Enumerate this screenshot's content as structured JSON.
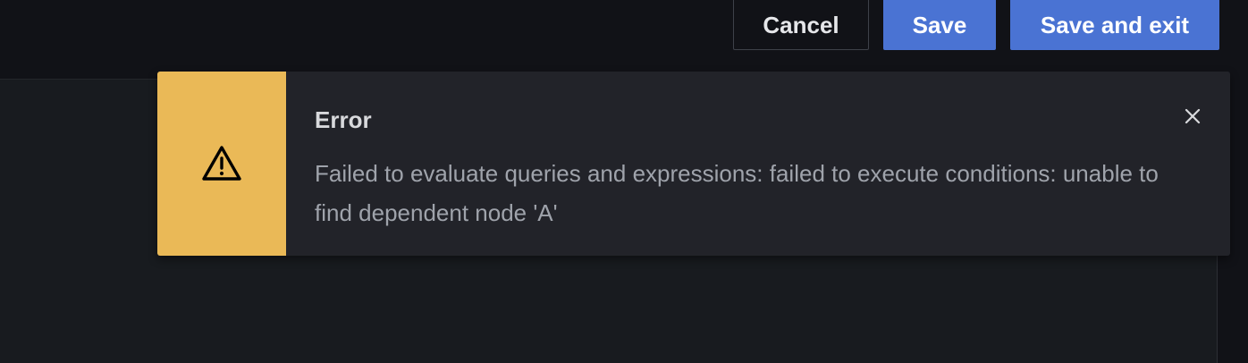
{
  "toolbar": {
    "cancel_label": "Cancel",
    "save_label": "Save",
    "save_exit_label": "Save and exit"
  },
  "alert": {
    "severity": "warning",
    "icon": "exclamation-triangle-icon",
    "title": "Error",
    "message": "Failed to evaluate queries and expressions: failed to execute conditions: unable to find dependent node 'A'",
    "close_icon": "close-icon"
  },
  "colors": {
    "accent_primary": "#4a73d3",
    "warning": "#eab957",
    "alert_background": "#222329",
    "page_background": "#111217"
  }
}
